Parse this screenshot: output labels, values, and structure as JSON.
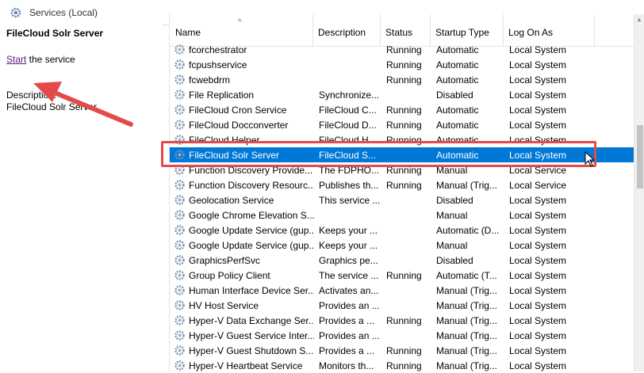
{
  "window": {
    "title": "Services (Local)",
    "icon": "gear-icon"
  },
  "left_pane": {
    "service_name": "FileCloud Solr Server",
    "start_link": "Start",
    "start_suffix": " the service",
    "description_label": "Description:",
    "description_value": "FileCloud Solr Server"
  },
  "columns": {
    "name": "Name",
    "description": "Description",
    "status": "Status",
    "startup_type": "Startup Type",
    "log_on_as": "Log On As"
  },
  "services": [
    {
      "name": "fcorchestrator",
      "description": "",
      "status": "Running",
      "startup": "Automatic",
      "logon": "Local System"
    },
    {
      "name": "fcpushservice",
      "description": "",
      "status": "Running",
      "startup": "Automatic",
      "logon": "Local System"
    },
    {
      "name": "fcwebdrm",
      "description": "",
      "status": "Running",
      "startup": "Automatic",
      "logon": "Local System"
    },
    {
      "name": "File Replication",
      "description": "Synchronize...",
      "status": "",
      "startup": "Disabled",
      "logon": "Local System"
    },
    {
      "name": "FileCloud Cron Service",
      "description": "FileCloud C...",
      "status": "Running",
      "startup": "Automatic",
      "logon": "Local System"
    },
    {
      "name": "FileCloud Docconverter",
      "description": "FileCloud D...",
      "status": "Running",
      "startup": "Automatic",
      "logon": "Local System"
    },
    {
      "name": "FileCloud Helper",
      "description": "FileCloud H...",
      "status": "Running",
      "startup": "Automatic",
      "logon": "Local System"
    },
    {
      "name": "FileCloud Solr Server",
      "description": "FileCloud S...",
      "status": "",
      "startup": "Automatic",
      "logon": "Local System",
      "selected": true
    },
    {
      "name": "Function Discovery Provide...",
      "description": "The FDPHO...",
      "status": "Running",
      "startup": "Manual",
      "logon": "Local Service"
    },
    {
      "name": "Function Discovery Resourc...",
      "description": "Publishes th...",
      "status": "Running",
      "startup": "Manual (Trig...",
      "logon": "Local Service"
    },
    {
      "name": "Geolocation Service",
      "description": "This service ...",
      "status": "",
      "startup": "Disabled",
      "logon": "Local System"
    },
    {
      "name": "Google Chrome Elevation S...",
      "description": "",
      "status": "",
      "startup": "Manual",
      "logon": "Local System"
    },
    {
      "name": "Google Update Service (gup...",
      "description": "Keeps your ...",
      "status": "",
      "startup": "Automatic (D...",
      "logon": "Local System"
    },
    {
      "name": "Google Update Service (gup...",
      "description": "Keeps your ...",
      "status": "",
      "startup": "Manual",
      "logon": "Local System"
    },
    {
      "name": "GraphicsPerfSvc",
      "description": "Graphics pe...",
      "status": "",
      "startup": "Disabled",
      "logon": "Local System"
    },
    {
      "name": "Group Policy Client",
      "description": "The service ...",
      "status": "Running",
      "startup": "Automatic (T...",
      "logon": "Local System"
    },
    {
      "name": "Human Interface Device Ser...",
      "description": "Activates an...",
      "status": "",
      "startup": "Manual (Trig...",
      "logon": "Local System"
    },
    {
      "name": "HV Host Service",
      "description": "Provides an ...",
      "status": "",
      "startup": "Manual (Trig...",
      "logon": "Local System"
    },
    {
      "name": "Hyper-V Data Exchange Ser...",
      "description": "Provides a ...",
      "status": "Running",
      "startup": "Manual (Trig...",
      "logon": "Local System"
    },
    {
      "name": "Hyper-V Guest Service Inter...",
      "description": "Provides an ...",
      "status": "",
      "startup": "Manual (Trig...",
      "logon": "Local System"
    },
    {
      "name": "Hyper-V Guest Shutdown S...",
      "description": "Provides a ...",
      "status": "Running",
      "startup": "Manual (Trig...",
      "logon": "Local System"
    },
    {
      "name": "Hyper-V Heartbeat Service",
      "description": "Monitors th...",
      "status": "Running",
      "startup": "Manual (Trig...",
      "logon": "Local System"
    }
  ],
  "colors": {
    "selection": "#0078d7",
    "annotation": "#e34b4b"
  }
}
